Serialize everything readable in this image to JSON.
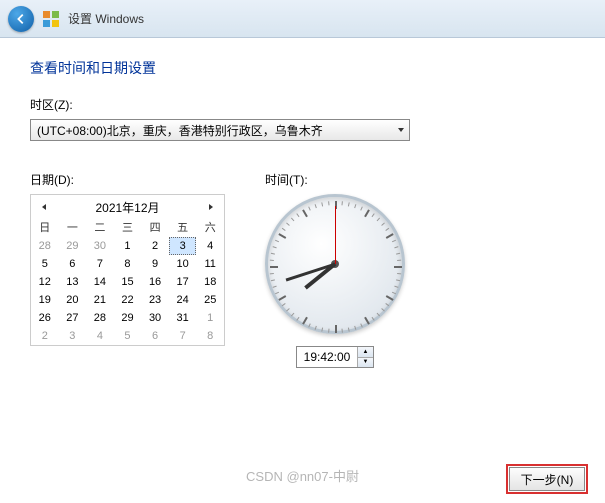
{
  "titlebar": {
    "title": "设置 Windows"
  },
  "heading": "查看时间和日期设置",
  "tz": {
    "label": "时区(Z):",
    "value": "(UTC+08:00)北京，重庆，香港特别行政区，乌鲁木齐"
  },
  "date": {
    "label": "日期(D):",
    "month_title": "2021年12月",
    "dow": [
      "日",
      "一",
      "二",
      "三",
      "四",
      "五",
      "六"
    ],
    "cells": [
      {
        "n": 28,
        "o": true
      },
      {
        "n": 29,
        "o": true
      },
      {
        "n": 30,
        "o": true
      },
      {
        "n": 1
      },
      {
        "n": 2
      },
      {
        "n": 3,
        "sel": true
      },
      {
        "n": 4
      },
      {
        "n": 5
      },
      {
        "n": 6
      },
      {
        "n": 7
      },
      {
        "n": 8
      },
      {
        "n": 9
      },
      {
        "n": 10
      },
      {
        "n": 11
      },
      {
        "n": 12
      },
      {
        "n": 13
      },
      {
        "n": 14
      },
      {
        "n": 15
      },
      {
        "n": 16
      },
      {
        "n": 17
      },
      {
        "n": 18
      },
      {
        "n": 19
      },
      {
        "n": 20
      },
      {
        "n": 21
      },
      {
        "n": 22
      },
      {
        "n": 23
      },
      {
        "n": 24
      },
      {
        "n": 25
      },
      {
        "n": 26
      },
      {
        "n": 27
      },
      {
        "n": 28
      },
      {
        "n": 29
      },
      {
        "n": 30
      },
      {
        "n": 31
      },
      {
        "n": 1,
        "o": true
      },
      {
        "n": 2,
        "o": true
      },
      {
        "n": 3,
        "o": true
      },
      {
        "n": 4,
        "o": true
      },
      {
        "n": 5,
        "o": true
      },
      {
        "n": 6,
        "o": true
      },
      {
        "n": 7,
        "o": true
      },
      {
        "n": 8,
        "o": true
      }
    ]
  },
  "time": {
    "label": "时间(T):",
    "value": "19:42:00",
    "hour_angle": 231,
    "min_angle": 252,
    "sec_angle": 0
  },
  "buttons": {
    "next": "下一步(N)"
  },
  "watermark": "CSDN @nn07-中尉"
}
